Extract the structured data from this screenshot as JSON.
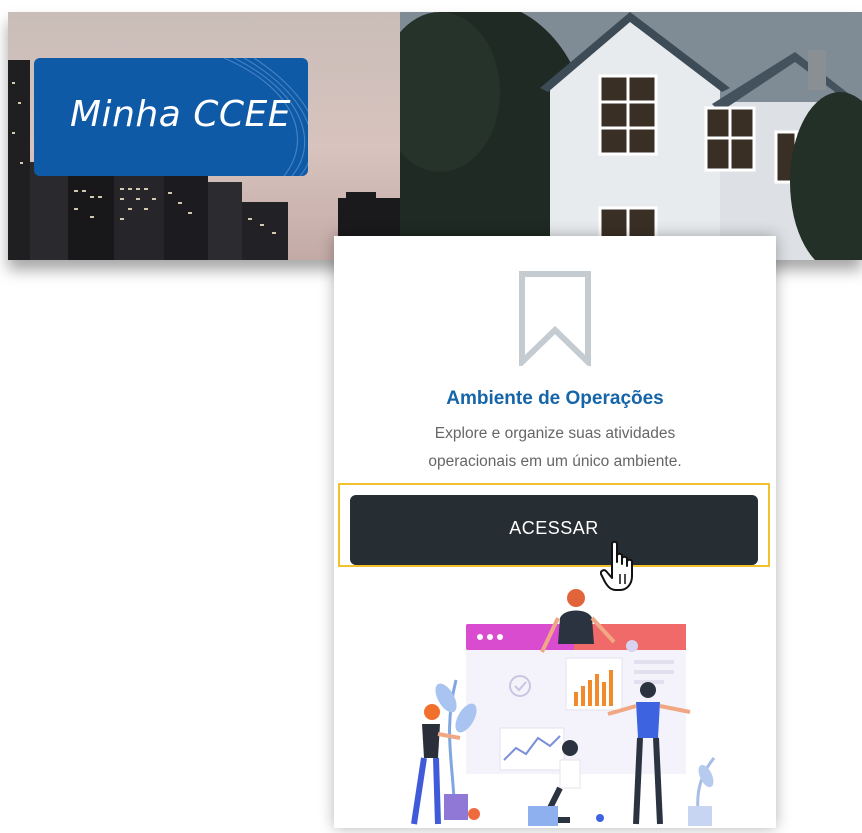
{
  "banner": {
    "brand_title": "Minha CCEE",
    "brand_color": "#0e5aa7"
  },
  "card": {
    "icon": "bookmark-icon",
    "title": "Ambiente de Operações",
    "description": "Explore e organize suas atividades operacionais em um único ambiente.",
    "button_label": "ACESSAR",
    "title_color": "#1565a8",
    "button_color": "#262d33",
    "highlight_color": "#f2c12e"
  },
  "cursor": "hand-pointer-icon",
  "illustration": "team-dashboard-illustration"
}
